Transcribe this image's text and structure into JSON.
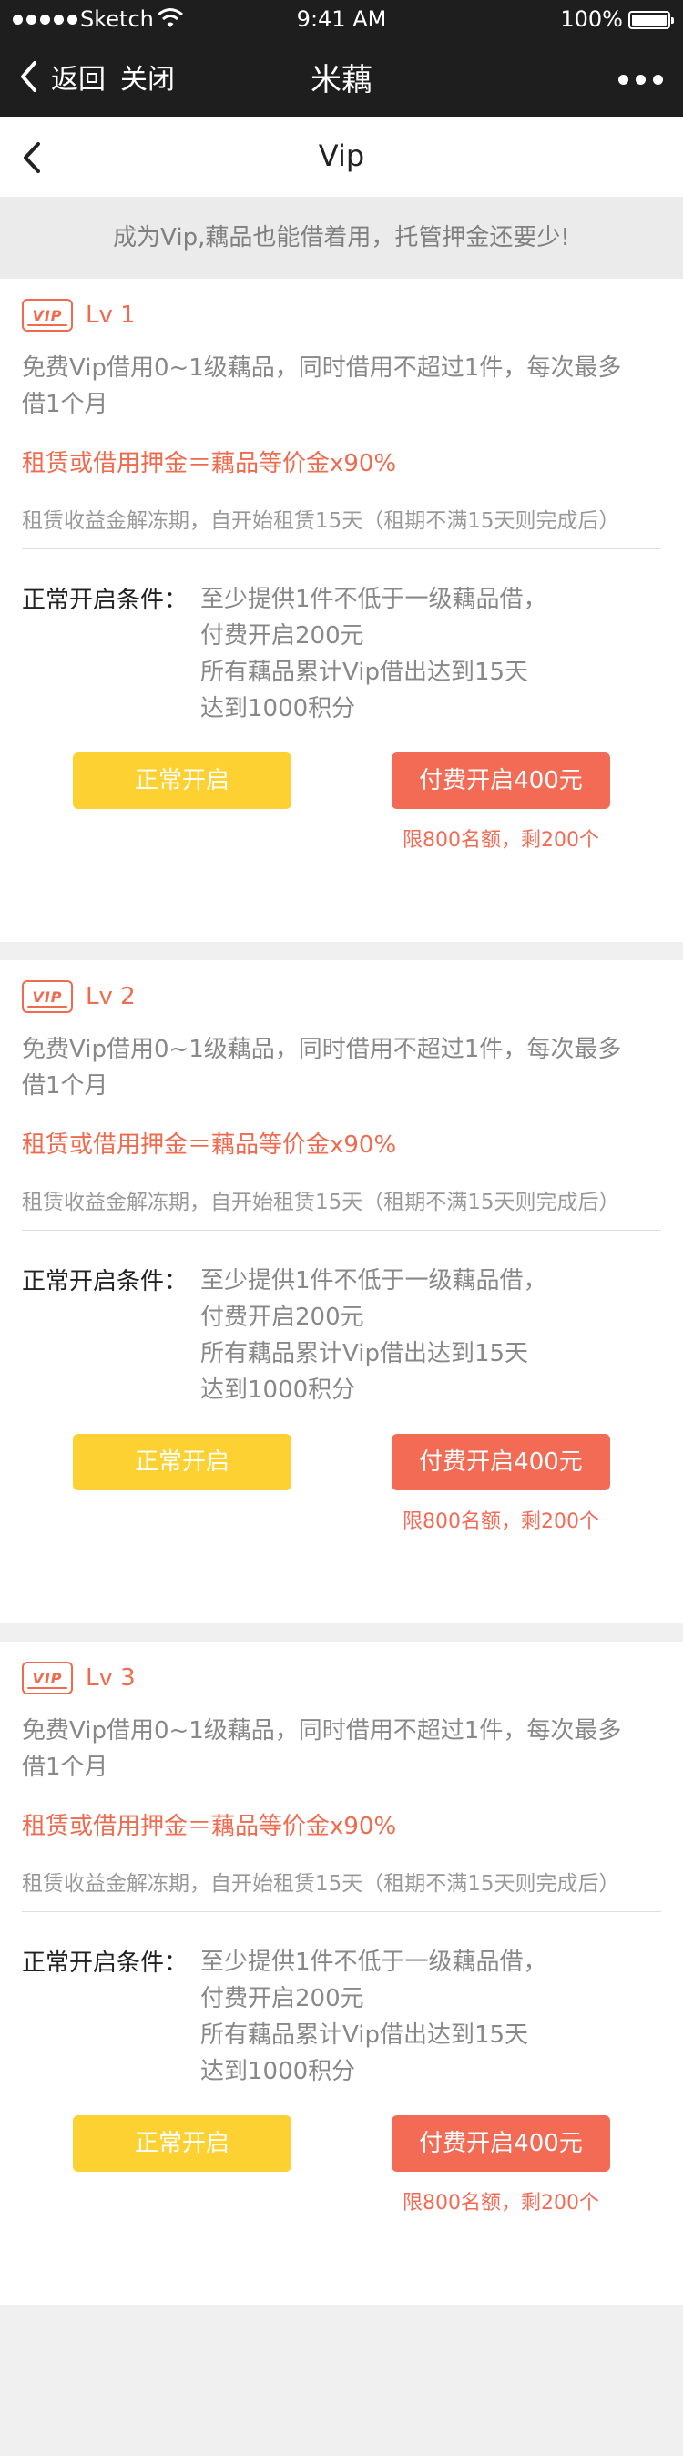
{
  "status_bar": {
    "carrier": "Sketch",
    "time": "9:41 AM",
    "battery": "100%"
  },
  "nav": {
    "back_label": "返回",
    "close_label": "关闭",
    "title": "米藕"
  },
  "page": {
    "title": "Vip",
    "banner": "成为Vip,藕品也能借着用，托管押金还要少!"
  },
  "badge_text": "VIP",
  "levels": [
    {
      "level": "Lv 1",
      "desc_line1": "免费Vip借用0~1级藕品，同时借用不超过1件，每次最多",
      "desc_line2": "借1个月",
      "formula": "租赁或借用押金＝藕品等价金x90%",
      "note": "租赁收益金解冻期，自开始租赁15天（租期不满15天则完成后）",
      "conditions_label": "正常开启条件：",
      "conditions": [
        "至少提供1件不低于一级藕品借，",
        "付费开启200元",
        "所有藕品累计Vip借出达到15天",
        "达到1000积分"
      ],
      "normal_button": "正常开启",
      "paid_button": "付费开启400元",
      "quota": "限800名额，剩200个"
    },
    {
      "level": "Lv 2",
      "desc_line1": "免费Vip借用0~1级藕品，同时借用不超过1件，每次最多",
      "desc_line2": "借1个月",
      "formula": "租赁或借用押金＝藕品等价金x90%",
      "note": "租赁收益金解冻期，自开始租赁15天（租期不满15天则完成后）",
      "conditions_label": "正常开启条件：",
      "conditions": [
        "至少提供1件不低于一级藕品借，",
        "付费开启200元",
        "所有藕品累计Vip借出达到15天",
        "达到1000积分"
      ],
      "normal_button": "正常开启",
      "paid_button": "付费开启400元",
      "quota": "限800名额，剩200个"
    },
    {
      "level": "Lv 3",
      "desc_line1": "免费Vip借用0~1级藕品，同时借用不超过1件，每次最多",
      "desc_line2": "借1个月",
      "formula": "租赁或借用押金＝藕品等价金x90%",
      "note": "租赁收益金解冻期，自开始租赁15天（租期不满15天则完成后）",
      "conditions_label": "正常开启条件：",
      "conditions": [
        "至少提供1件不低于一级藕品借，",
        "付费开启200元",
        "所有藕品累计Vip借出达到15天",
        "达到1000积分"
      ],
      "normal_button": "正常开启",
      "paid_button": "付费开启400元",
      "quota": "限800名额，剩200个"
    }
  ],
  "colors": {
    "accent": "#f06a4e",
    "paid_button": "#f36b55",
    "normal_button": "#fdd132",
    "topbar": "#1e1e1e"
  }
}
